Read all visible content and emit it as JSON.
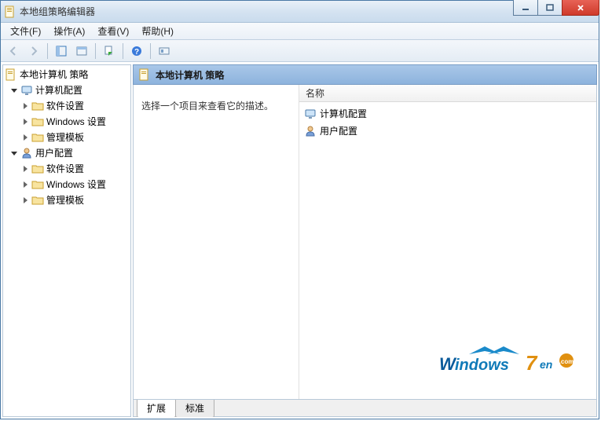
{
  "window": {
    "title": "本地组策略编辑器"
  },
  "menu": {
    "file": "文件(F)",
    "action": "操作(A)",
    "view": "查看(V)",
    "help": "帮助(H)"
  },
  "tree": {
    "root": "本地计算机 策略",
    "computer": "计算机配置",
    "user": "用户配置",
    "software": "软件设置",
    "windows": "Windows 设置",
    "templates": "管理模板"
  },
  "detail": {
    "heading": "本地计算机 策略",
    "prompt": "选择一个项目来查看它的描述。",
    "name_col": "名称",
    "items": {
      "computer": "计算机配置",
      "user": "用户配置"
    }
  },
  "tabs": {
    "extended": "扩展",
    "standard": "标准"
  },
  "watermark": "Windows7en"
}
